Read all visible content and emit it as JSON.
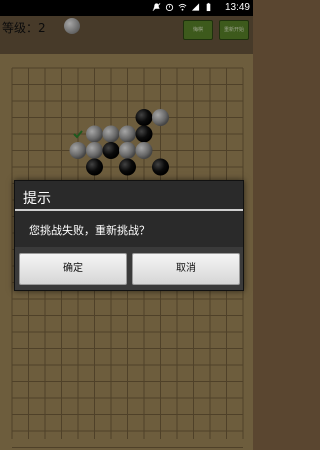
{
  "status_bar": {
    "time": "13:49",
    "icons": [
      "no-notifications-icon",
      "alarm-icon",
      "wifi-icon",
      "signal-icon",
      "battery-icon"
    ]
  },
  "game": {
    "level_label": "等级：2",
    "current_turn": "white",
    "buttons": [
      {
        "id": "a",
        "label": "悔棋"
      },
      {
        "id": "b",
        "label": "重新开始"
      }
    ],
    "board": {
      "cols": 15,
      "rows": 15,
      "stones": [
        {
          "color": "black",
          "col": 8,
          "row": 3
        },
        {
          "color": "white",
          "col": 9,
          "row": 3
        },
        {
          "color": "white",
          "col": 5,
          "row": 4
        },
        {
          "color": "white",
          "col": 6,
          "row": 4
        },
        {
          "color": "white",
          "col": 7,
          "row": 4
        },
        {
          "color": "black",
          "col": 8,
          "row": 4
        },
        {
          "color": "white",
          "col": 4,
          "row": 5
        },
        {
          "color": "white",
          "col": 5,
          "row": 5
        },
        {
          "color": "black",
          "col": 6,
          "row": 5
        },
        {
          "color": "white",
          "col": 7,
          "row": 5
        },
        {
          "color": "white",
          "col": 8,
          "row": 5
        },
        {
          "color": "black",
          "col": 5,
          "row": 6
        },
        {
          "color": "black",
          "col": 7,
          "row": 6
        },
        {
          "color": "black",
          "col": 9,
          "row": 6
        }
      ],
      "last_move_marker": {
        "col": 4,
        "row": 4
      }
    }
  },
  "dialog": {
    "title": "提示",
    "message": "您挑战失败，重新挑战？",
    "confirm_label": "确定",
    "cancel_label": "取消"
  },
  "colors": {
    "board": "#a88f5f",
    "grid_line": "#7a6440",
    "button_green": "#5f8a2c",
    "dialog_bg": "#2a2a2a"
  }
}
